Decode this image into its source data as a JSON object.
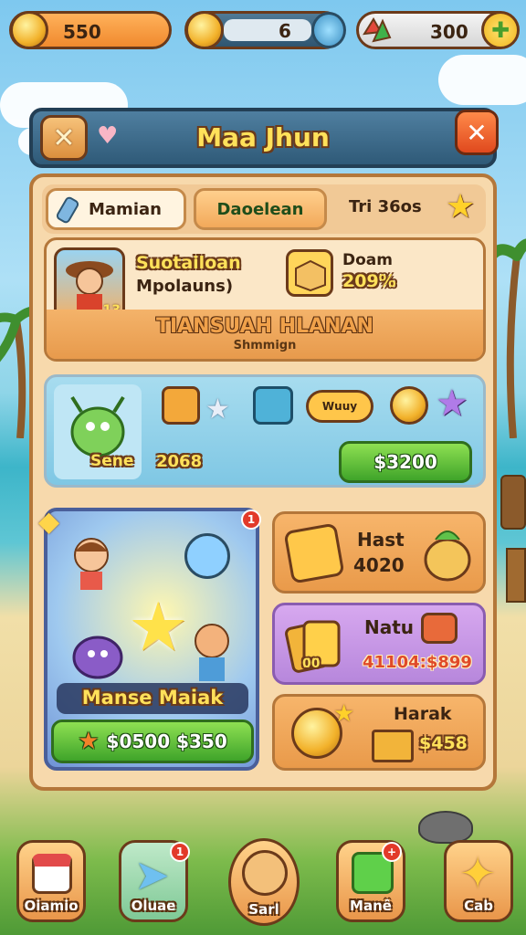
{
  "top_bar": {
    "coins_value": "550",
    "middle_value": "6",
    "gems_value": "300"
  },
  "title_bar": {
    "title": "Maa Jhun"
  },
  "tabs": [
    {
      "label": "Mamian"
    },
    {
      "label": "Daoelean"
    },
    {
      "label": "Tri 36os"
    }
  ],
  "profile": {
    "name_line1": "Suotailoan",
    "name_line2": "Mpolauns)",
    "avatar_badge": "13",
    "stat_label": "Doam",
    "stat_value": "209%",
    "banner_title": "TIANSUAH HLANAN",
    "banner_sub": "Shmmign"
  },
  "reward_row": {
    "speech_text": "Wuuy",
    "name_label": "Sene",
    "number": "2068",
    "button_label": "$3200"
  },
  "featured": {
    "badge": "1",
    "name": "Manse Maiak",
    "button_label": "$0500 $350"
  },
  "side_offers": [
    {
      "title": "Hast",
      "value": "4020"
    },
    {
      "title": "Natu",
      "left_value": "00",
      "price": "41104:$899"
    },
    {
      "title": "Harak",
      "price": "$458"
    }
  ],
  "nav": [
    {
      "label": "Oiamio",
      "badge": ""
    },
    {
      "label": "Oluae",
      "badge": "1"
    },
    {
      "label": "Sarl",
      "badge": ""
    },
    {
      "label": "Manê",
      "badge": "+"
    },
    {
      "label": "Cab",
      "badge": ""
    }
  ],
  "colors": {
    "panel_fill": "#f7d9ac",
    "panel_border": "#b4773a",
    "title_bar_fill": "#3e6b85",
    "button_green": "#4fb632",
    "close_red": "#e9572d"
  }
}
